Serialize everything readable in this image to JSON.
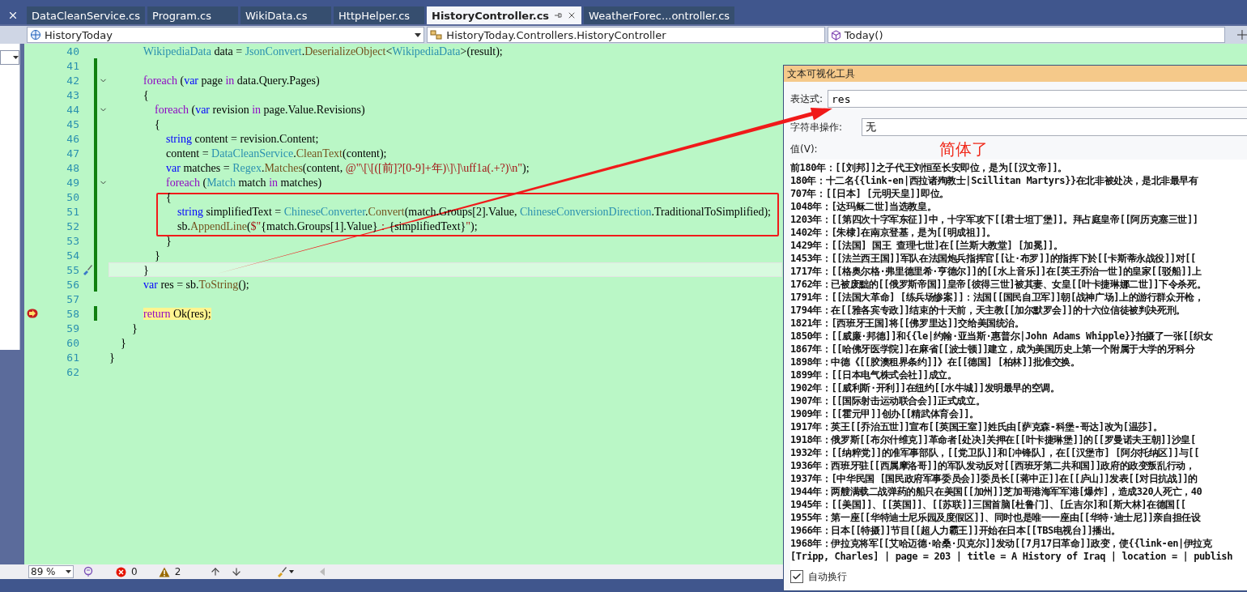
{
  "tabs": [
    {
      "label": "DataCleanService.cs",
      "selected": false
    },
    {
      "label": "Program.cs",
      "selected": false
    },
    {
      "label": "WikiData.cs",
      "selected": false
    },
    {
      "label": "HttpHelper.cs",
      "selected": false
    },
    {
      "label": "HistoryController.cs",
      "selected": true
    },
    {
      "label": "WeatherForec...ontroller.cs",
      "selected": false
    }
  ],
  "navigation": {
    "project": "HistoryToday",
    "type": "HistoryToday.Controllers.HistoryController",
    "member": "Today()"
  },
  "editor": {
    "lines": [
      {
        "number": "40",
        "changed": false,
        "foldable": false,
        "current": false,
        "executing": false,
        "tokens": [
          {
            "kind": "type",
            "text": "            WikipediaData"
          },
          {
            "kind": "plain",
            "text": " data = "
          },
          {
            "kind": "type",
            "text": "JsonConvert"
          },
          {
            "kind": "plain",
            "text": "."
          },
          {
            "kind": "method",
            "text": "DeserializeObject"
          },
          {
            "kind": "plain",
            "text": "<"
          },
          {
            "kind": "type",
            "text": "WikipediaData"
          },
          {
            "kind": "plain",
            "text": ">(result);"
          }
        ]
      },
      {
        "number": "41",
        "changed": true,
        "foldable": false,
        "current": false,
        "executing": false
      },
      {
        "number": "42",
        "changed": true,
        "foldable": true,
        "current": false,
        "executing": false,
        "tokens": [
          {
            "kind": "control",
            "text": "            foreach"
          },
          {
            "kind": "plain",
            "text": " ("
          },
          {
            "kind": "keyword",
            "text": "var"
          },
          {
            "kind": "plain",
            "text": " page "
          },
          {
            "kind": "control",
            "text": "in"
          },
          {
            "kind": "plain",
            "text": " data.Query.Pages)"
          }
        ]
      },
      {
        "number": "43",
        "changed": true,
        "foldable": false,
        "current": false,
        "executing": false,
        "tokens": [
          {
            "kind": "plain",
            "text": "            {"
          }
        ]
      },
      {
        "number": "44",
        "changed": true,
        "foldable": true,
        "current": false,
        "executing": false,
        "tokens": [
          {
            "kind": "control",
            "text": "                foreach"
          },
          {
            "kind": "plain",
            "text": " ("
          },
          {
            "kind": "keyword",
            "text": "var"
          },
          {
            "kind": "plain",
            "text": " revision "
          },
          {
            "kind": "control",
            "text": "in"
          },
          {
            "kind": "plain",
            "text": " page.Value.Revisions)"
          }
        ]
      },
      {
        "number": "45",
        "changed": true,
        "foldable": false,
        "current": false,
        "executing": false,
        "tokens": [
          {
            "kind": "plain",
            "text": "                {"
          }
        ]
      },
      {
        "number": "46",
        "changed": true,
        "foldable": false,
        "current": false,
        "executing": false,
        "tokens": [
          {
            "kind": "keyword",
            "text": "                    string"
          },
          {
            "kind": "plain",
            "text": " content = revision.Content;"
          }
        ]
      },
      {
        "number": "47",
        "changed": true,
        "foldable": false,
        "current": false,
        "executing": false,
        "tokens": [
          {
            "kind": "plain",
            "text": "                    content = "
          },
          {
            "kind": "type",
            "text": "DataCleanService"
          },
          {
            "kind": "plain",
            "text": "."
          },
          {
            "kind": "method",
            "text": "CleanText"
          },
          {
            "kind": "plain",
            "text": "(content);"
          }
        ]
      },
      {
        "number": "48",
        "changed": true,
        "foldable": false,
        "current": false,
        "executing": false,
        "tokens": [
          {
            "kind": "keyword",
            "text": "                    var"
          },
          {
            "kind": "plain",
            "text": " matches = "
          },
          {
            "kind": "type",
            "text": "Regex"
          },
          {
            "kind": "plain",
            "text": "."
          },
          {
            "kind": "method",
            "text": "Matches"
          },
          {
            "kind": "plain",
            "text": "(content, "
          },
          {
            "kind": "string",
            "text": "@\"\\[\\[([前]?[0-9]+年)\\]\\]\\uff1a(.+?)\\n\""
          },
          {
            "kind": "plain",
            "text": ");"
          }
        ]
      },
      {
        "number": "49",
        "changed": true,
        "foldable": true,
        "current": false,
        "executing": false,
        "tokens": [
          {
            "kind": "control",
            "text": "                    foreach"
          },
          {
            "kind": "plain",
            "text": " ("
          },
          {
            "kind": "type",
            "text": "Match"
          },
          {
            "kind": "plain",
            "text": " match "
          },
          {
            "kind": "control",
            "text": "in"
          },
          {
            "kind": "plain",
            "text": " matches)"
          }
        ]
      },
      {
        "number": "50",
        "changed": true,
        "foldable": false,
        "current": false,
        "executing": false,
        "tokens": [
          {
            "kind": "plain",
            "text": "                    {"
          }
        ]
      },
      {
        "number": "51",
        "changed": true,
        "foldable": false,
        "current": false,
        "executing": false,
        "tokens": [
          {
            "kind": "keyword",
            "text": "                        string"
          },
          {
            "kind": "plain",
            "text": " simplifiedText = "
          },
          {
            "kind": "type",
            "text": "ChineseConverter"
          },
          {
            "kind": "plain",
            "text": "."
          },
          {
            "kind": "method",
            "text": "Convert"
          },
          {
            "kind": "plain",
            "text": "(match.Groups[2].Value, "
          },
          {
            "kind": "type",
            "text": "ChineseConversionDirection"
          },
          {
            "kind": "plain",
            "text": ".TraditionalToSimplified);"
          }
        ]
      },
      {
        "number": "52",
        "changed": true,
        "foldable": false,
        "current": false,
        "executing": false,
        "tokens": [
          {
            "kind": "plain",
            "text": "                        sb."
          },
          {
            "kind": "method",
            "text": "AppendLine"
          },
          {
            "kind": "plain",
            "text": "("
          },
          {
            "kind": "string",
            "text": "$\""
          },
          {
            "kind": "plain",
            "text": "{match.Groups[1].Value}"
          },
          {
            "kind": "string",
            "text": "："
          },
          {
            "kind": "plain",
            "text": "{simplifiedText}"
          },
          {
            "kind": "string",
            "text": "\""
          },
          {
            "kind": "plain",
            "text": ");"
          }
        ]
      },
      {
        "number": "53",
        "changed": true,
        "foldable": false,
        "current": false,
        "executing": false,
        "tokens": [
          {
            "kind": "plain",
            "text": "                    }"
          }
        ]
      },
      {
        "number": "54",
        "changed": true,
        "foldable": false,
        "current": false,
        "executing": false,
        "tokens": [
          {
            "kind": "plain",
            "text": "                }"
          }
        ]
      },
      {
        "number": "55",
        "changed": true,
        "foldable": false,
        "current": true,
        "executing": false,
        "tokens": [
          {
            "kind": "plain",
            "text": "            }"
          }
        ]
      },
      {
        "number": "56",
        "changed": true,
        "foldable": false,
        "current": false,
        "executing": false,
        "tokens": [
          {
            "kind": "keyword",
            "text": "            var"
          },
          {
            "kind": "plain",
            "text": " res = sb."
          },
          {
            "kind": "method",
            "text": "ToString"
          },
          {
            "kind": "plain",
            "text": "();"
          }
        ]
      },
      {
        "number": "57",
        "changed": false,
        "foldable": false,
        "current": false,
        "executing": false
      },
      {
        "number": "58",
        "changed": true,
        "foldable": false,
        "current": false,
        "executing": true,
        "tokens": [
          {
            "kind": "control",
            "text": "            return"
          },
          {
            "kind": "plain",
            "text": " Ok(res);"
          }
        ]
      },
      {
        "number": "59",
        "changed": false,
        "foldable": false,
        "current": false,
        "executing": false,
        "tokens": [
          {
            "kind": "plain",
            "text": "        }"
          }
        ]
      },
      {
        "number": "60",
        "changed": false,
        "foldable": false,
        "current": false,
        "executing": false,
        "tokens": [
          {
            "kind": "plain",
            "text": "    }"
          }
        ]
      },
      {
        "number": "61",
        "changed": false,
        "foldable": false,
        "current": false,
        "executing": false,
        "tokens": [
          {
            "kind": "plain",
            "text": "}"
          }
        ]
      },
      {
        "number": "62",
        "changed": false,
        "foldable": false,
        "current": false,
        "executing": false
      }
    ]
  },
  "status_bar": {
    "zoom": "89 %",
    "errors": "0",
    "warnings": "2"
  },
  "visualizer": {
    "title": "文本可视化工具",
    "expression_label": "表达式:",
    "expression": "res",
    "operation_label": "字符串操作:",
    "operation": "无",
    "value_label": "值(V):",
    "note": "简体了",
    "output_lines": [
      "前180年：[[刘邦]]之子代王刘恒至长安即位，是为[[汉文帝]]。",
      "180年：十二名{{link-en|西拉诸殉教士|Scillitan Martyrs}}在北非被处决，是北非最早有",
      "707年：[[日本] [元明天皇]]即位。",
      "1048年：[达玛稣二世]当选教皇。",
      "1203年：[[第四次十字军东征]]中，十字军攻下[[君士坦丁堡]]。拜占庭皇帝[[阿历克塞三世]]",
      "1402年：[朱棣]在南京登基，是为[[明成祖]]。",
      "1429年：[[法国] 国王 查理七世]在[[兰斯大教堂] [加冕]]。",
      "1453年：[[法兰西王国]]军队在法国炮兵指挥官[[让·布罗]]的指挥下於[[卡斯蒂永战役]]对[[",
      "1717年：[[格奥尔格·弗里德里希·亨德尔]]的[[水上音乐]]在[英王乔治一世]的皇家[[驳船]]上",
      "1762年：已被废黜的[[俄罗斯帝国]]皇帝[彼得三世]被其妻、女皇[[叶卡捷琳娜二世]]下令杀死。",
      "1791年：[[法国大革命] [练兵场惨案]]：法国[[国民自卫军]]朝[战神广场]上的游行群众开枪，",
      "1794年：在[[雅各宾专政]]结束的十天前，天主教[[加尔默罗会]]的十六位信徒被判决死刑。",
      "1821年：[西班牙王国]将[[佛罗里达]]交给美国统治。",
      "1850年：[[威廉·邦德]]和{{le|约翰·亚当斯·惠普尔|John Adams Whipple}}拍摄了一张[[织女",
      "1867年：[[哈佛牙医学院]]在麻省[[波士顿]]建立，成为美国历史上第一个附属于大学的牙科分",
      "1898年：中德《[[胶澳租界条约]]》在[[德国] [柏林]]批准交换。",
      "1899年：[[日本电气株式会社]]成立。",
      "1902年：[[威利斯·开利]]在纽约[[水牛城]]发明最早的空调。",
      "1907年：[[国际射击运动联合会]]正式成立。",
      "1909年：[[霍元甲]]创办[[精武体育会]]。",
      "1917年：英王[[乔治五世]]宣布[[英国王室]]姓氏由[萨克森-科堡-哥达]改为[温莎]。",
      "1918年：俄罗斯[[布尔什维克]]革命者[处决]关押在[[叶卡捷琳堡]]的[[罗曼诺夫王朝]]沙皇[",
      "1932年：[[纳粹党]]的准军事部队，[[党卫队]]和[冲锋队]，在[[汉堡市] [阿尔托纳区]]与[[",
      "1936年：西班牙驻[[西属摩洛哥]]的军队发动反对[[西班牙第二共和国]]政府的政变叛乱行动，",
      "1937年：[中华民国 [国民政府军事委员会]]委员长[[蒋中正]]在[[庐山]]发表[[对日抗战]]的",
      "1944年：两艘满载二战弹药的船只在美国[[加州]]芝加哥港海军军港[爆炸]，造成320人死亡，40",
      "1945年：[[美国]]、[[英国]]、[[苏联]]三国首脑[杜鲁门]、[丘吉尔]和[斯大林]在德国[[",
      "1955年：第一座[[华特迪士尼乐园及度假区]]、同时也是唯一一座由[[华特·迪士尼]]亲自担任设",
      "1966年：日本[[特摄]]节目[[超人力霸王]]开始在日本[[TBS电视台]]播出。",
      "1968年：伊拉克将军[[艾哈迈德·哈桑·贝克尔]]发动[[7月17日革命]]政变，使{{link-en|伊拉克",
      "[Tripp, Charles] | page = 203 | title = A History of Iraq | location = | publish"
    ],
    "word_wrap": {
      "label": "自动换行",
      "checked": true
    }
  }
}
